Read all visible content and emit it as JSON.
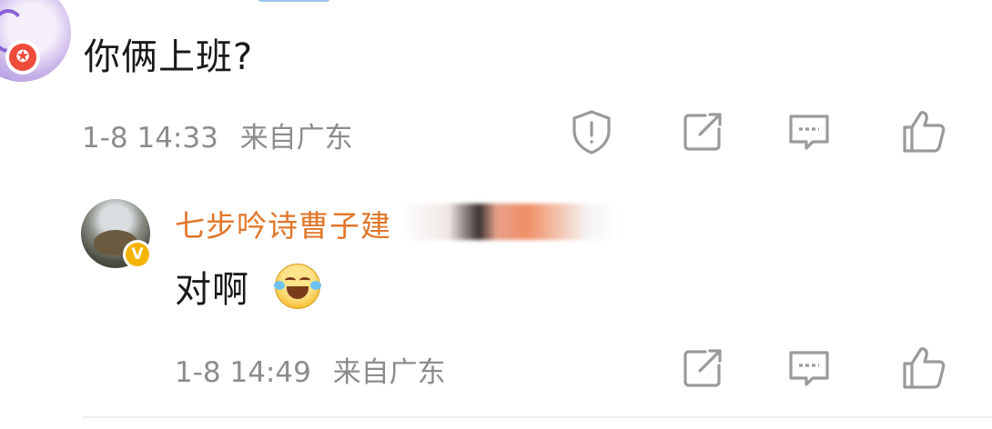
{
  "comments": [
    {
      "text": "你俩上班?",
      "time": "1-8 14:33",
      "location": "来自广东",
      "badge_glyph": "✪",
      "actions": [
        "report",
        "share",
        "comment",
        "like"
      ]
    },
    {
      "username": "七步吟诗曹子建",
      "text": "对啊",
      "emoji": "laughing-crying",
      "time": "1-8 14:49",
      "location": "来自广东",
      "badge_glyph": "V",
      "actions": [
        "share",
        "comment",
        "like"
      ]
    }
  ],
  "colors": {
    "username": "#e1762a",
    "meta": "#8c8c8c",
    "icon": "#9a9a9a",
    "badge_red": "#ee4b3a",
    "badge_gold": "#f5b400"
  }
}
